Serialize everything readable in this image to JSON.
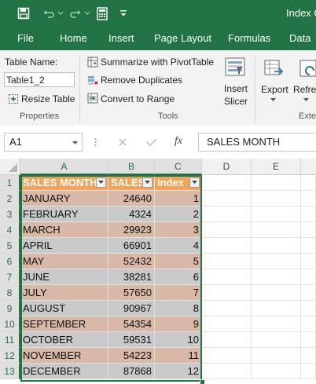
{
  "titlebar": {
    "title": "Index C"
  },
  "tabs": [
    "File",
    "Home",
    "Insert",
    "Page Layout",
    "Formulas",
    "Data"
  ],
  "ribbon": {
    "properties": {
      "table_name_label": "Table Name:",
      "table_name_value": "Table1_2",
      "resize_label": "Resize Table",
      "group_label": "Properties"
    },
    "tools": {
      "summarize_label": "Summarize with PivotTable",
      "remove_dup_label": "Remove Duplicates",
      "convert_label": "Convert to Range",
      "insert_slicer_line1": "Insert",
      "insert_slicer_line2": "Slicer",
      "group_label": "Tools"
    },
    "external": {
      "export_label": "Export",
      "refresh_label": "Refres",
      "group_label": "Exte"
    }
  },
  "formula_bar": {
    "name_box": "A1",
    "fx": "fx",
    "content": "SALES MONTH"
  },
  "grid": {
    "columns": [
      "A",
      "B",
      "C",
      "D",
      "E"
    ],
    "header": [
      "SALES MONTH",
      "SALES",
      "Index"
    ],
    "rows": [
      {
        "n": "2",
        "month": "JANUARY",
        "sales": "24640",
        "index": "1"
      },
      {
        "n": "3",
        "month": "FEBRUARY",
        "sales": "4324",
        "index": "2"
      },
      {
        "n": "4",
        "month": "MARCH",
        "sales": "29923",
        "index": "3"
      },
      {
        "n": "5",
        "month": "APRIL",
        "sales": "66901",
        "index": "4"
      },
      {
        "n": "6",
        "month": "MAY",
        "sales": "52432",
        "index": "5"
      },
      {
        "n": "7",
        "month": "JUNE",
        "sales": "38281",
        "index": "6"
      },
      {
        "n": "8",
        "month": "JULY",
        "sales": "57650",
        "index": "7"
      },
      {
        "n": "9",
        "month": "AUGUST",
        "sales": "90967",
        "index": "8"
      },
      {
        "n": "10",
        "month": "SEPTEMBER",
        "sales": "54354",
        "index": "9"
      },
      {
        "n": "11",
        "month": "OCTOBER",
        "sales": "59531",
        "index": "10"
      },
      {
        "n": "12",
        "month": "NOVEMBER",
        "sales": "54223",
        "index": "11"
      },
      {
        "n": "13",
        "month": "DECEMBER",
        "sales": "87868",
        "index": "12"
      }
    ]
  },
  "colors": {
    "accent": "#217346",
    "table_header": "#f4a259",
    "band_odd": "#d8b8a7",
    "band_even": "#c9c9c9"
  }
}
